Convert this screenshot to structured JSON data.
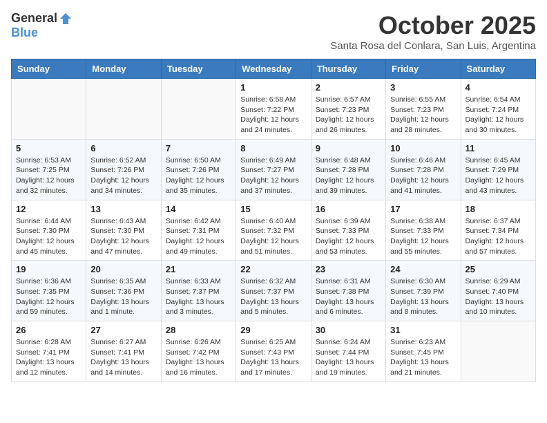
{
  "header": {
    "logo_general": "General",
    "logo_blue": "Blue",
    "month_title": "October 2025",
    "location": "Santa Rosa del Conlara, San Luis, Argentina"
  },
  "weekdays": [
    "Sunday",
    "Monday",
    "Tuesday",
    "Wednesday",
    "Thursday",
    "Friday",
    "Saturday"
  ],
  "weeks": [
    [
      {
        "day": "",
        "info": ""
      },
      {
        "day": "",
        "info": ""
      },
      {
        "day": "",
        "info": ""
      },
      {
        "day": "1",
        "info": "Sunrise: 6:58 AM\nSunset: 7:22 PM\nDaylight: 12 hours\nand 24 minutes."
      },
      {
        "day": "2",
        "info": "Sunrise: 6:57 AM\nSunset: 7:23 PM\nDaylight: 12 hours\nand 26 minutes."
      },
      {
        "day": "3",
        "info": "Sunrise: 6:55 AM\nSunset: 7:23 PM\nDaylight: 12 hours\nand 28 minutes."
      },
      {
        "day": "4",
        "info": "Sunrise: 6:54 AM\nSunset: 7:24 PM\nDaylight: 12 hours\nand 30 minutes."
      }
    ],
    [
      {
        "day": "5",
        "info": "Sunrise: 6:53 AM\nSunset: 7:25 PM\nDaylight: 12 hours\nand 32 minutes."
      },
      {
        "day": "6",
        "info": "Sunrise: 6:52 AM\nSunset: 7:26 PM\nDaylight: 12 hours\nand 34 minutes."
      },
      {
        "day": "7",
        "info": "Sunrise: 6:50 AM\nSunset: 7:26 PM\nDaylight: 12 hours\nand 35 minutes."
      },
      {
        "day": "8",
        "info": "Sunrise: 6:49 AM\nSunset: 7:27 PM\nDaylight: 12 hours\nand 37 minutes."
      },
      {
        "day": "9",
        "info": "Sunrise: 6:48 AM\nSunset: 7:28 PM\nDaylight: 12 hours\nand 39 minutes."
      },
      {
        "day": "10",
        "info": "Sunrise: 6:46 AM\nSunset: 7:28 PM\nDaylight: 12 hours\nand 41 minutes."
      },
      {
        "day": "11",
        "info": "Sunrise: 6:45 AM\nSunset: 7:29 PM\nDaylight: 12 hours\nand 43 minutes."
      }
    ],
    [
      {
        "day": "12",
        "info": "Sunrise: 6:44 AM\nSunset: 7:30 PM\nDaylight: 12 hours\nand 45 minutes."
      },
      {
        "day": "13",
        "info": "Sunrise: 6:43 AM\nSunset: 7:30 PM\nDaylight: 12 hours\nand 47 minutes."
      },
      {
        "day": "14",
        "info": "Sunrise: 6:42 AM\nSunset: 7:31 PM\nDaylight: 12 hours\nand 49 minutes."
      },
      {
        "day": "15",
        "info": "Sunrise: 6:40 AM\nSunset: 7:32 PM\nDaylight: 12 hours\nand 51 minutes."
      },
      {
        "day": "16",
        "info": "Sunrise: 6:39 AM\nSunset: 7:33 PM\nDaylight: 12 hours\nand 53 minutes."
      },
      {
        "day": "17",
        "info": "Sunrise: 6:38 AM\nSunset: 7:33 PM\nDaylight: 12 hours\nand 55 minutes."
      },
      {
        "day": "18",
        "info": "Sunrise: 6:37 AM\nSunset: 7:34 PM\nDaylight: 12 hours\nand 57 minutes."
      }
    ],
    [
      {
        "day": "19",
        "info": "Sunrise: 6:36 AM\nSunset: 7:35 PM\nDaylight: 12 hours\nand 59 minutes."
      },
      {
        "day": "20",
        "info": "Sunrise: 6:35 AM\nSunset: 7:36 PM\nDaylight: 13 hours\nand 1 minute."
      },
      {
        "day": "21",
        "info": "Sunrise: 6:33 AM\nSunset: 7:37 PM\nDaylight: 13 hours\nand 3 minutes."
      },
      {
        "day": "22",
        "info": "Sunrise: 6:32 AM\nSunset: 7:37 PM\nDaylight: 13 hours\nand 5 minutes."
      },
      {
        "day": "23",
        "info": "Sunrise: 6:31 AM\nSunset: 7:38 PM\nDaylight: 13 hours\nand 6 minutes."
      },
      {
        "day": "24",
        "info": "Sunrise: 6:30 AM\nSunset: 7:39 PM\nDaylight: 13 hours\nand 8 minutes."
      },
      {
        "day": "25",
        "info": "Sunrise: 6:29 AM\nSunset: 7:40 PM\nDaylight: 13 hours\nand 10 minutes."
      }
    ],
    [
      {
        "day": "26",
        "info": "Sunrise: 6:28 AM\nSunset: 7:41 PM\nDaylight: 13 hours\nand 12 minutes."
      },
      {
        "day": "27",
        "info": "Sunrise: 6:27 AM\nSunset: 7:41 PM\nDaylight: 13 hours\nand 14 minutes."
      },
      {
        "day": "28",
        "info": "Sunrise: 6:26 AM\nSunset: 7:42 PM\nDaylight: 13 hours\nand 16 minutes."
      },
      {
        "day": "29",
        "info": "Sunrise: 6:25 AM\nSunset: 7:43 PM\nDaylight: 13 hours\nand 17 minutes."
      },
      {
        "day": "30",
        "info": "Sunrise: 6:24 AM\nSunset: 7:44 PM\nDaylight: 13 hours\nand 19 minutes."
      },
      {
        "day": "31",
        "info": "Sunrise: 6:23 AM\nSunset: 7:45 PM\nDaylight: 13 hours\nand 21 minutes."
      },
      {
        "day": "",
        "info": ""
      }
    ]
  ]
}
